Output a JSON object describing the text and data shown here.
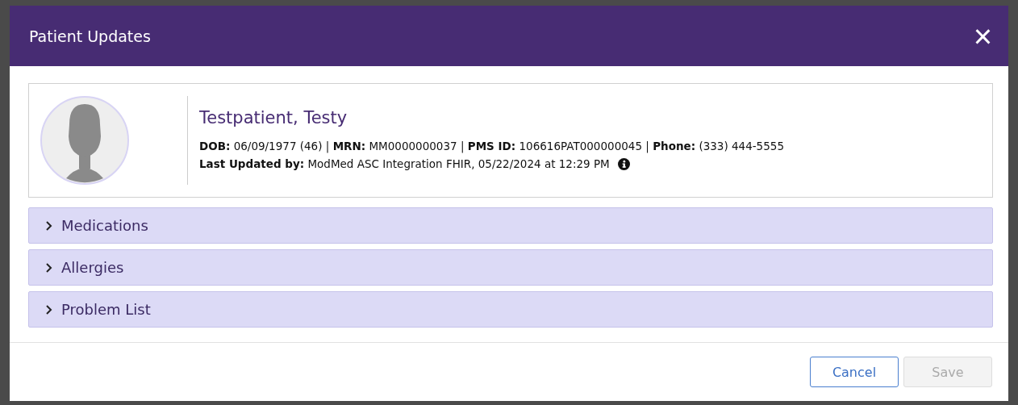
{
  "window": {
    "title": "Patient Updates",
    "close": "×"
  },
  "patient": {
    "name": "Testpatient, Testy",
    "details": "**DOB:** 06/09/1977 (46) | **MRN:** MM0000000037 | **PMS ID:** 106616PAT000000045 | **Phone:** (333) 444-5555",
    "updated": "**Last Updated by:** ModMed ASC Integration FHIR, 05/22/2024 at 12:29 PM"
  },
  "sections": [
    {
      "label": "Medications",
      "expanded": false
    },
    {
      "label": "Allergies",
      "expanded": false
    },
    {
      "label": "Problem List",
      "expanded": false
    }
  ],
  "buttons": [
    {
      "label": "Cancel",
      "disabled": false,
      "kind": "outline"
    },
    {
      "label": "Save",
      "disabled": true,
      "kind": "primary"
    }
  ]
}
